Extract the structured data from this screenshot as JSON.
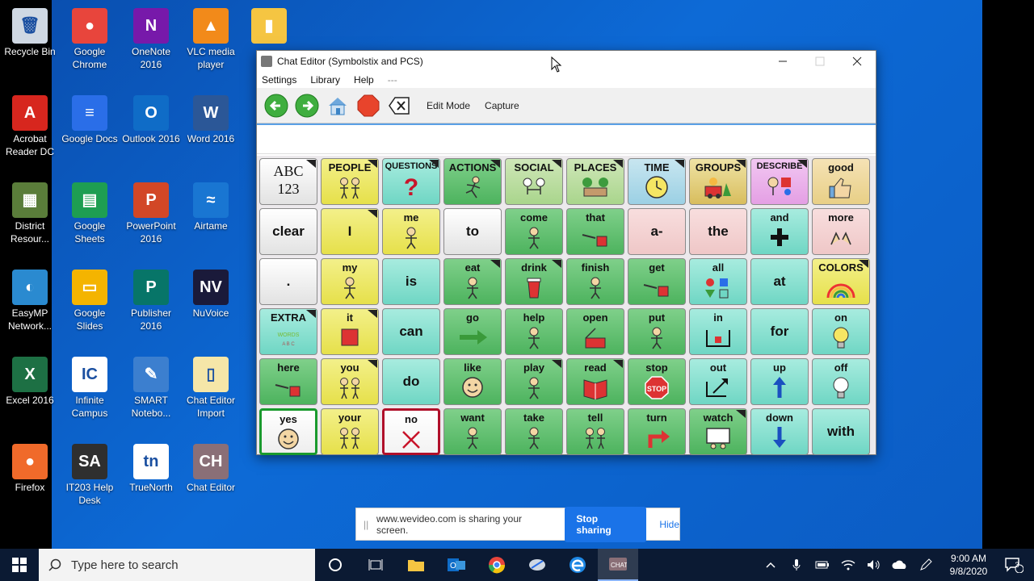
{
  "desktop": {
    "icons": [
      {
        "label": "Recycle Bin",
        "glyph": "🗑",
        "color": "#cfd8e3"
      },
      {
        "label": "Google Chrome",
        "glyph": "●",
        "color": "#e8453c"
      },
      {
        "label": "OneNote 2016",
        "glyph": "N",
        "color": "#7719aa"
      },
      {
        "label": "VLC media player",
        "glyph": "▲",
        "color": "#f28a1a"
      },
      {
        "label": "",
        "glyph": "▮",
        "color": "#f5c542"
      },
      {
        "label": "Acrobat Reader DC",
        "glyph": "A",
        "color": "#d7261e"
      },
      {
        "label": "Google Docs",
        "glyph": "≡",
        "color": "#2a6ee8"
      },
      {
        "label": "Outlook 2016",
        "glyph": "O",
        "color": "#0f6cc7"
      },
      {
        "label": "Word 2016",
        "glyph": "W",
        "color": "#2b5797"
      },
      {
        "label": "District Resour...",
        "glyph": "▦",
        "color": "#5a7d3a"
      },
      {
        "label": "Google Sheets",
        "glyph": "▤",
        "color": "#1e9e52"
      },
      {
        "label": "PowerPoint 2016",
        "glyph": "P",
        "color": "#d24726"
      },
      {
        "label": "Airtame",
        "glyph": "≈",
        "color": "#1976d2"
      },
      {
        "label": "EasyMP Network...",
        "glyph": "◐",
        "color": "#2a8ad0"
      },
      {
        "label": "Google Slides",
        "glyph": "▭",
        "color": "#f4b400"
      },
      {
        "label": "Publisher 2016",
        "glyph": "P",
        "color": "#077568"
      },
      {
        "label": "NuVoice",
        "glyph": "NV",
        "color": "#1a1a3a"
      },
      {
        "label": "Excel 2016",
        "glyph": "X",
        "color": "#1d7044"
      },
      {
        "label": "Infinite Campus",
        "glyph": "IC",
        "color": "#ffffff"
      },
      {
        "label": "SMART Notebo...",
        "glyph": "✎",
        "color": "#3c7fcf"
      },
      {
        "label": "Chat Editor Import",
        "glyph": "▯",
        "color": "#f5e6a8"
      },
      {
        "label": "Firefox",
        "glyph": "●",
        "color": "#f06a2a"
      },
      {
        "label": "IT203 Help Desk",
        "glyph": "SA",
        "color": "#2f2f2f"
      },
      {
        "label": "TrueNorth",
        "glyph": "tn",
        "color": "#ffffff"
      },
      {
        "label": "Chat Editor",
        "glyph": "CH",
        "color": "#8a6f77"
      }
    ]
  },
  "window": {
    "title": "Chat Editor (Symbolstix and PCS)",
    "menu": [
      "Settings",
      "Library",
      "Help",
      "---"
    ],
    "toolbar": {
      "edit_mode": "Edit Mode",
      "capture": "Capture"
    },
    "message_text": ""
  },
  "grid": [
    {
      "word": "ABC\n123",
      "color": "grey",
      "folder": true,
      "sym": "abc"
    },
    {
      "word": "PEOPLE",
      "color": "yellow",
      "folder": true,
      "sym": "people"
    },
    {
      "word": "QUESTIONS",
      "color": "teal",
      "folder": true,
      "sym": "question"
    },
    {
      "word": "ACTIONS",
      "color": "green",
      "folder": true,
      "sym": "action"
    },
    {
      "word": "SOCIAL",
      "color": "lgreen",
      "folder": true,
      "sym": "social"
    },
    {
      "word": "PLACES",
      "color": "lgreen",
      "folder": true,
      "sym": "places"
    },
    {
      "word": "TIME",
      "color": "blue",
      "folder": true,
      "sym": "clock"
    },
    {
      "word": "GROUPS",
      "color": "brown",
      "folder": true,
      "sym": "groups"
    },
    {
      "word": "DESCRIBE",
      "color": "purple",
      "folder": true,
      "sym": "describe"
    },
    {
      "word": "good",
      "color": "peach",
      "folder": false,
      "sym": "thumb"
    },
    {
      "word": "clear",
      "color": "grey",
      "folder": false,
      "sym": ""
    },
    {
      "word": "I",
      "color": "yellow",
      "folder": true,
      "sym": ""
    },
    {
      "word": "me",
      "color": "yellow",
      "folder": false,
      "sym": "person"
    },
    {
      "word": "to",
      "color": "grey",
      "folder": false,
      "sym": ""
    },
    {
      "word": "come",
      "color": "green",
      "folder": false,
      "sym": "person"
    },
    {
      "word": "that",
      "color": "green",
      "folder": false,
      "sym": "point"
    },
    {
      "word": "a-",
      "color": "pink",
      "folder": false,
      "sym": ""
    },
    {
      "word": "the",
      "color": "pink",
      "folder": false,
      "sym": ""
    },
    {
      "word": "and",
      "color": "teal",
      "folder": false,
      "sym": "plus"
    },
    {
      "word": "more",
      "color": "pink",
      "folder": false,
      "sym": "hands"
    },
    {
      "word": ".",
      "color": "grey",
      "folder": false,
      "sym": ""
    },
    {
      "word": "my",
      "color": "yellow",
      "folder": false,
      "sym": "person"
    },
    {
      "word": "is",
      "color": "teal",
      "folder": false,
      "sym": ""
    },
    {
      "word": "eat",
      "color": "green",
      "folder": true,
      "sym": "person"
    },
    {
      "word": "drink",
      "color": "green",
      "folder": true,
      "sym": "cup"
    },
    {
      "word": "finish",
      "color": "green",
      "folder": false,
      "sym": "person"
    },
    {
      "word": "get",
      "color": "green",
      "folder": false,
      "sym": "point"
    },
    {
      "word": "all",
      "color": "teal",
      "folder": false,
      "sym": "shapes"
    },
    {
      "word": "at",
      "color": "teal",
      "folder": false,
      "sym": ""
    },
    {
      "word": "COLORS",
      "color": "yellow",
      "folder": true,
      "sym": "rainbow"
    },
    {
      "word": "EXTRA",
      "color": "teal",
      "folder": true,
      "sym": "words"
    },
    {
      "word": "it",
      "color": "yellow",
      "folder": true,
      "sym": "redsquare"
    },
    {
      "word": "can",
      "color": "teal",
      "folder": false,
      "sym": ""
    },
    {
      "word": "go",
      "color": "green",
      "folder": false,
      "sym": "arrow"
    },
    {
      "word": "help",
      "color": "green",
      "folder": false,
      "sym": "person"
    },
    {
      "word": "open",
      "color": "green",
      "folder": false,
      "sym": "box"
    },
    {
      "word": "put",
      "color": "green",
      "folder": false,
      "sym": "person"
    },
    {
      "word": "in",
      "color": "teal",
      "folder": false,
      "sym": "inbox"
    },
    {
      "word": "for",
      "color": "teal",
      "folder": false,
      "sym": ""
    },
    {
      "word": "on",
      "color": "teal",
      "folder": false,
      "sym": "bulb"
    },
    {
      "word": "here",
      "color": "green",
      "folder": false,
      "sym": "point"
    },
    {
      "word": "you",
      "color": "yellow",
      "folder": true,
      "sym": "people"
    },
    {
      "word": "do",
      "color": "teal",
      "folder": false,
      "sym": ""
    },
    {
      "word": "like",
      "color": "green",
      "folder": false,
      "sym": "smile"
    },
    {
      "word": "play",
      "color": "green",
      "folder": true,
      "sym": "person"
    },
    {
      "word": "read",
      "color": "green",
      "folder": true,
      "sym": "book"
    },
    {
      "word": "stop",
      "color": "green",
      "folder": false,
      "sym": "stopsign"
    },
    {
      "word": "out",
      "color": "teal",
      "folder": false,
      "sym": "outarrow"
    },
    {
      "word": "up",
      "color": "teal",
      "folder": false,
      "sym": "uparrow"
    },
    {
      "word": "off",
      "color": "teal",
      "folder": false,
      "sym": "bulboff"
    },
    {
      "word": "yes",
      "color": "yes",
      "folder": false,
      "sym": "smile"
    },
    {
      "word": "your",
      "color": "yellow",
      "folder": false,
      "sym": "people"
    },
    {
      "word": "no",
      "color": "no",
      "folder": false,
      "sym": "x"
    },
    {
      "word": "want",
      "color": "green",
      "folder": false,
      "sym": "person"
    },
    {
      "word": "take",
      "color": "green",
      "folder": false,
      "sym": "person"
    },
    {
      "word": "tell",
      "color": "green",
      "folder": false,
      "sym": "people"
    },
    {
      "word": "turn",
      "color": "green",
      "folder": false,
      "sym": "turnarrow"
    },
    {
      "word": "watch",
      "color": "green",
      "folder": true,
      "sym": "tv"
    },
    {
      "word": "down",
      "color": "teal",
      "folder": false,
      "sym": "downarrow"
    },
    {
      "word": "with",
      "color": "teal",
      "folder": false,
      "sym": ""
    }
  ],
  "share_banner": {
    "message": "www.wevideo.com is sharing your screen.",
    "stop_label": "Stop sharing",
    "hide_label": "Hide"
  },
  "taskbar": {
    "search_placeholder": "Type here to search",
    "time": "9:00 AM",
    "date": "9/8/2020",
    "notification_count": "3"
  }
}
